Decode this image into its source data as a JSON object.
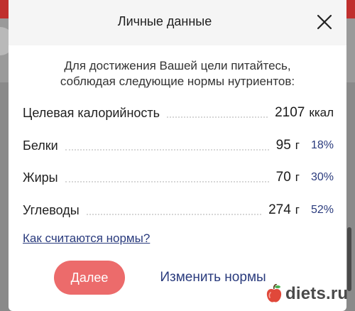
{
  "modal": {
    "title": "Личные данные",
    "intro_line1": "Для достижения Вашей цели питайтесь,",
    "intro_line2": "соблюдая следующие нормы нутриентов:",
    "rows": [
      {
        "label": "Целевая калорийность",
        "value": "2107",
        "unit": "ккал",
        "percent": ""
      },
      {
        "label": "Белки",
        "value": "95",
        "unit": "г",
        "percent": "18%"
      },
      {
        "label": "Жиры",
        "value": "70",
        "unit": "г",
        "percent": "30%"
      },
      {
        "label": "Углеводы",
        "value": "274",
        "unit": "г",
        "percent": "52%"
      }
    ],
    "link_label": "Как считаются нормы?",
    "primary_button": "Далее",
    "secondary_button": "Изменить нормы"
  },
  "watermark": {
    "text": "diets.ru",
    "icon": "apple-icon"
  },
  "colors": {
    "accent_button": "#ec6b6b",
    "link": "#2a3b7d",
    "header_bg": "#f5f5f5",
    "app_bar": "#c0302e"
  }
}
